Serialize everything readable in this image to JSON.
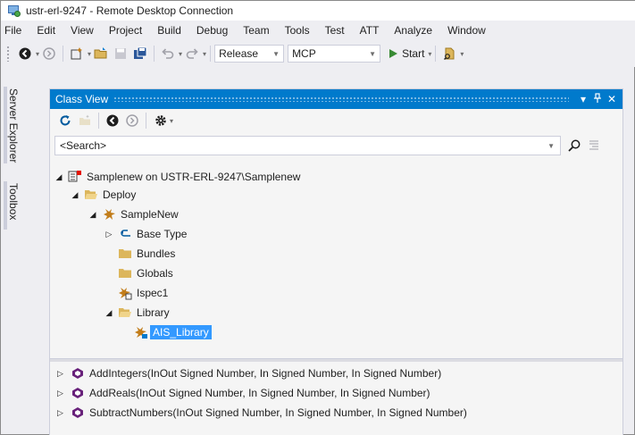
{
  "window": {
    "title": "ustr-erl-9247 - Remote Desktop Connection"
  },
  "menu": {
    "items": [
      "File",
      "Edit",
      "View",
      "Project",
      "Build",
      "Debug",
      "Team",
      "Tools",
      "Test",
      "ATT",
      "Analyze",
      "Window"
    ]
  },
  "toolbar": {
    "config_value": "Release",
    "platform_value": "MCP",
    "start_label": "Start"
  },
  "side_tabs": {
    "server_explorer": "Server Explorer",
    "toolbox": "Toolbox"
  },
  "panel": {
    "title": "Class View",
    "pin_glyph": "✷",
    "close_glyph": "✕",
    "search_placeholder": "<Search>"
  },
  "tree": {
    "project": "Samplenew on USTR-ERL-9247\\Samplenew",
    "deploy": "Deploy",
    "samplenew": "SampleNew",
    "base_type": "Base Type",
    "bundles": "Bundles",
    "globals": "Globals",
    "ispec1": "Ispec1",
    "library": "Library",
    "ais_library": "AIS_Library"
  },
  "members": [
    "AddIntegers(InOut Signed Number, In Signed Number, In Signed Number)",
    "AddReals(InOut Signed Number, In Signed Number, In Signed Number)",
    "SubtractNumbers(InOut Signed Number, In Signed Number, In Signed Number)"
  ],
  "colors": {
    "accent": "#007acc",
    "selection": "#3399ff",
    "folder": "#dcb65c",
    "member_icon": "#68217a",
    "play": "#388a34"
  }
}
